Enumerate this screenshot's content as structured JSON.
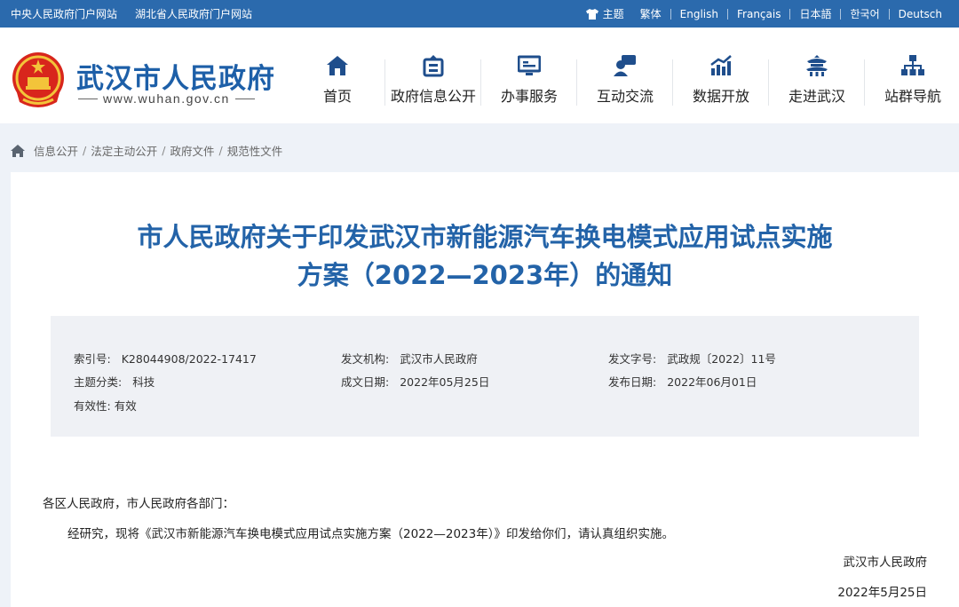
{
  "topbar": {
    "left_links": [
      "中央人民政府门户网站",
      "湖北省人民政府门户网站"
    ],
    "theme_label": "主题",
    "languages": [
      "繁体",
      "English",
      "Français",
      "日本語",
      "한국어",
      "Deutsch"
    ]
  },
  "header": {
    "site_title": "武汉市人民政府",
    "site_url": "www.wuhan.gov.cn",
    "nav": [
      {
        "label": "首页",
        "icon": "home-icon"
      },
      {
        "label": "政府信息公开",
        "icon": "info-disclosure-icon"
      },
      {
        "label": "办事服务",
        "icon": "service-icon"
      },
      {
        "label": "互动交流",
        "icon": "interaction-icon"
      },
      {
        "label": "数据开放",
        "icon": "data-chart-icon"
      },
      {
        "label": "走进武汉",
        "icon": "pavilion-icon"
      },
      {
        "label": "站群导航",
        "icon": "sitemap-icon"
      }
    ]
  },
  "breadcrumb": [
    "信息公开",
    "法定主动公开",
    "政府文件",
    "规范性文件"
  ],
  "article": {
    "title_line1": "市人民政府关于印发武汉市新能源汽车换电模式应用试点实施",
    "title_line2": "方案（2022—2023年）的通知",
    "meta": {
      "index_label": "索引号:",
      "index_value": "K28044908/2022-17417",
      "issuer_label": "发文机构:",
      "issuer_value": "武汉市人民政府",
      "docno_label": "发文字号:",
      "docno_value": "武政规〔2022〕11号",
      "topic_label": "主题分类:",
      "topic_value": "科技",
      "created_label": "成文日期:",
      "created_value": "2022年05月25日",
      "published_label": "发布日期:",
      "published_value": "2022年06月01日",
      "validity_label": "有效性:",
      "validity_value": "有效"
    },
    "salutation": "各区人民政府，市人民政府各部门：",
    "paragraph": "经研究，现将《武汉市新能源汽车换电模式应用试点实施方案（2022—2023年）》印发给你们，请认真组织实施。",
    "signature": "武汉市人民政府",
    "date": "2022年5月25日"
  },
  "colors": {
    "topbar": "#2b6aad",
    "title": "#2363a8",
    "brand": "#1d5fa8",
    "nav_icon": "#1f4e8c"
  }
}
